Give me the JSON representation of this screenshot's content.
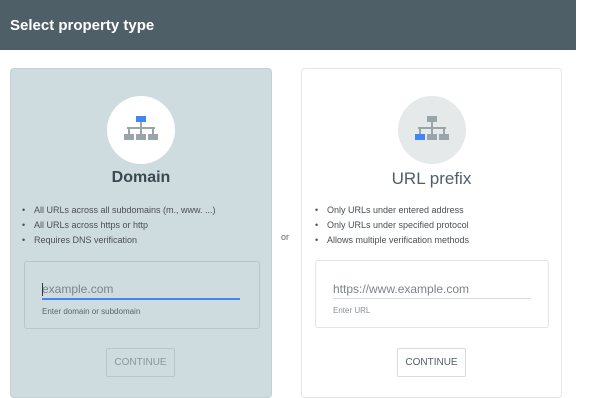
{
  "header": {
    "title": "Select property type"
  },
  "divider_text": "or",
  "domain_card": {
    "icon": "sitemap-icon",
    "title": "Domain",
    "bullets": [
      "All URLs across all subdomains (m., www. ...)",
      "All URLs across https or http",
      "Requires DNS verification"
    ],
    "input_placeholder": "example.com",
    "helper_text": "Enter domain or subdomain",
    "button_label": "CONTINUE"
  },
  "url_card": {
    "icon": "sitemap-icon",
    "title": "URL prefix",
    "bullets": [
      "Only URLs under entered address",
      "Only URLs under specified protocol",
      "Allows multiple verification methods"
    ],
    "input_placeholder": "https://www.example.com",
    "helper_text": "Enter URL",
    "button_label": "CONTINUE"
  },
  "colors": {
    "header_bg": "#4f5f68",
    "domain_card_bg": "#cfdcdf",
    "accent_blue": "#4285f4"
  }
}
